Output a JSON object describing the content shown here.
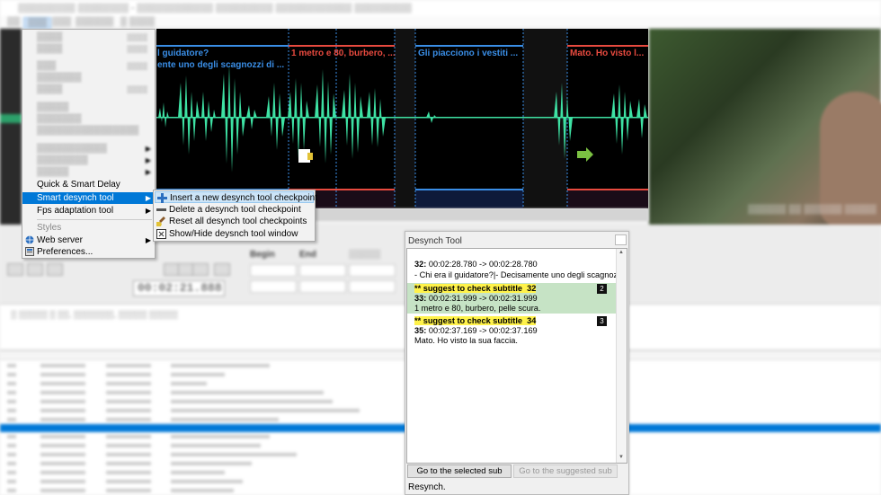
{
  "waveform": {
    "segments": [
      {
        "text": "l guidatore?",
        "color": "#3a8ee6"
      },
      {
        "text": "ente uno degli scagnozzi di ...",
        "color": "#3a8ee6"
      },
      {
        "text": "1 metro e 80, burbero, ...",
        "color": "#e84a3f"
      },
      {
        "text": "Gli piacciono i vestiti ...",
        "color": "#3a8ee6"
      },
      {
        "text": "Mato. Ho visto l...",
        "color": "#e84a3f"
      }
    ]
  },
  "edit_menu": {
    "items": [
      {
        "label": "Quick & Smart Delay"
      },
      {
        "label": "Smart desynch tool",
        "submenu": true
      },
      {
        "label": "Fps adaptation tool",
        "submenu": true
      },
      {
        "label": "Styles"
      },
      {
        "label": "Web server",
        "submenu": true
      },
      {
        "label": "Preferences..."
      }
    ]
  },
  "submenu": {
    "items": [
      {
        "label": "Insert a new desynch tool checkpoint"
      },
      {
        "label": "Delete a desynch tool checkpoint"
      },
      {
        "label": "Reset all desynch tool checkpoints"
      },
      {
        "label": "Show/Hide deysnch tool window"
      }
    ]
  },
  "background": {
    "time_display": "00:02:21.888",
    "col_begin": "Begin",
    "col_end": "End"
  },
  "desynch_window": {
    "title": "Desynch Tool",
    "entries": [
      {
        "num_label": "32:",
        "times": "00:02:28.780 -> 00:02:28.780",
        "text": "- Chi era il guidatore?|- Decisamente uno degli scagnozzi di Kirk."
      },
      {
        "suggest_label": "** suggest to check subtitle",
        "suggest_num": "32",
        "badge": "2",
        "num_label": "33:",
        "times": "00:02:31.999 -> 00:02:31.999",
        "text": "1 metro e 80, burbero, pelle scura."
      },
      {
        "suggest_label": "** suggest to check subtitle",
        "suggest_num": "34",
        "badge": "3",
        "num_label": "35:",
        "times": "00:02:37.169 -> 00:02:37.169",
        "text": "Mato. Ho visto la sua faccia."
      }
    ],
    "btn_goto_selected": "Go to the selected sub",
    "btn_goto_suggested": "Go to the suggested sub",
    "status": "Resynch."
  },
  "colors": {
    "wave": "#3ee2a4",
    "selection": "#0078d7",
    "suggest_highlight": "#fff24a",
    "entry_green": "#c6e3c5"
  }
}
